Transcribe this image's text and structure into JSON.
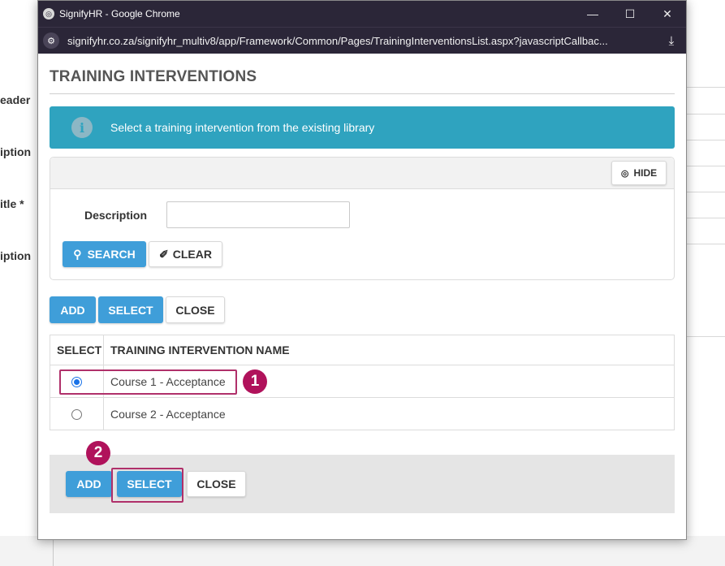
{
  "background": {
    "labels": [
      {
        "text": "eader",
        "required": false
      },
      {
        "text": "iption",
        "required": false
      },
      {
        "text": "itle",
        "required": true
      },
      {
        "text": "iption",
        "required": false
      }
    ],
    "required_mark": "*"
  },
  "window": {
    "title": "SignifyHR - Google Chrome",
    "url": "signifyhr.co.za/signifyhr_multiv8/app/Framework/Common/Pages/TrainingInterventionsList.aspx?javascriptCallbac...",
    "minimize_icon": "minimize-icon",
    "maximize_icon": "maximize-icon",
    "close_icon": "close-icon"
  },
  "page": {
    "title": "TRAINING INTERVENTIONS",
    "alert_text": "Select a training intervention from the existing library",
    "alert_color": "#2fa3bf"
  },
  "filter": {
    "hide_label": "HIDE",
    "description_label": "Description",
    "description_value": "",
    "search_label": "SEARCH",
    "clear_label": "CLEAR"
  },
  "actions": {
    "add_label": "ADD",
    "select_label": "SELECT",
    "close_label": "CLOSE"
  },
  "table": {
    "headers": [
      "SELECT",
      "TRAINING INTERVENTION NAME"
    ],
    "rows": [
      {
        "name": "Course 1 - Acceptance",
        "selected": true
      },
      {
        "name": "Course 2 - Acceptance",
        "selected": false
      }
    ]
  },
  "footer": {
    "add_label": "ADD",
    "select_label": "SELECT",
    "close_label": "CLOSE"
  },
  "annotations": {
    "badge_1": "1",
    "badge_2": "2",
    "highlight_color": "#b0306a",
    "badge_color": "#b0125b"
  },
  "colors": {
    "primary_button": "#3f9ed9",
    "titlebar": "#2b2638"
  }
}
